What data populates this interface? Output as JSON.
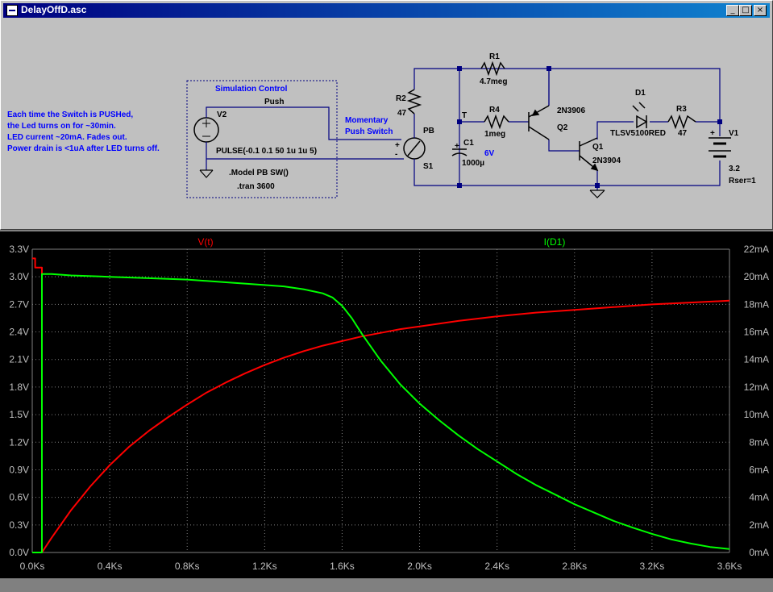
{
  "window": {
    "title": "DelayOffD.asc",
    "buttons": {
      "minimize": "_",
      "maximize": "□",
      "close": "×"
    }
  },
  "schematic": {
    "notes": [
      "Each time the Switch is PUSHed,",
      "the Led turns on for ~30min.",
      "LED current ~20mA. Fades out.",
      "Power drain is <1uA after LED turns off."
    ],
    "sim_box_title": "Simulation Control",
    "push_label": "Push",
    "v2_name": "V2",
    "v2_value": "PULSE(-0.1 0.1 50 1u 1u 5)",
    "model_line": ".Model PB SW()",
    "tran_line": ".tran 3600",
    "switch_note": [
      "Momentary",
      "Push Switch"
    ],
    "pb_label": "PB",
    "s1_label": "S1",
    "switch_plus": "+",
    "switch_minus": "-",
    "r2_name": "R2",
    "r2_value": "47",
    "r1_name": "R1",
    "r1_value": "4.7meg",
    "r4_name": "R4",
    "r4_value": "1meg",
    "node_t": "T",
    "c1_name": "C1",
    "c1_value": "1000µ",
    "c1_plus": "+",
    "node_6v": "6V",
    "q2_model": "2N3906",
    "q2_name": "Q2",
    "q1_name": "Q1",
    "q1_model": "2N3904",
    "d1_name": "D1",
    "d1_model": "TLSV5100RED",
    "r3_name": "R3",
    "r3_value": "47",
    "v1_name": "V1",
    "v1_value": "3.2",
    "v1_rser": "Rser=1",
    "v1_plus": "+",
    "colors": {
      "wire": "#000080",
      "component": "#000000",
      "note": "#0000ff",
      "node": "#0000ff"
    }
  },
  "plot": {
    "trace_labels": {
      "left": "V(t)",
      "right": "I(D1)"
    },
    "y_left_ticks": [
      "0.0V",
      "0.3V",
      "0.6V",
      "0.9V",
      "1.2V",
      "1.5V",
      "1.8V",
      "2.1V",
      "2.4V",
      "2.7V",
      "3.0V",
      "3.3V"
    ],
    "y_right_ticks": [
      "0mA",
      "2mA",
      "4mA",
      "6mA",
      "8mA",
      "10mA",
      "12mA",
      "14mA",
      "16mA",
      "18mA",
      "20mA",
      "22mA"
    ],
    "x_ticks": [
      "0.0Ks",
      "0.4Ks",
      "0.8Ks",
      "1.2Ks",
      "1.6Ks",
      "2.0Ks",
      "2.4Ks",
      "2.8Ks",
      "3.2Ks",
      "3.6Ks"
    ],
    "colors": {
      "background": "#000000",
      "grid": "#808080",
      "axis_text": "#c0c0c0",
      "vt": "#ff0000",
      "id1": "#00ff00"
    }
  },
  "chart_data": {
    "type": "line",
    "title": "",
    "xlabel": "",
    "ylabel": "",
    "xlim": [
      0,
      3600
    ],
    "ylim_left": [
      0,
      3.3
    ],
    "ylim_right": [
      0,
      22
    ],
    "grid": true,
    "series": [
      {
        "name": "V(t)",
        "axis": "left",
        "unit": "V",
        "color": "#ff0000",
        "points": [
          [
            0,
            3.2
          ],
          [
            15,
            3.2
          ],
          [
            15,
            3.1
          ],
          [
            50,
            3.1
          ],
          [
            50,
            0
          ],
          [
            100,
            0.16
          ],
          [
            200,
            0.46
          ],
          [
            300,
            0.72
          ],
          [
            400,
            0.95
          ],
          [
            500,
            1.15
          ],
          [
            600,
            1.32
          ],
          [
            700,
            1.47
          ],
          [
            800,
            1.61
          ],
          [
            900,
            1.74
          ],
          [
            1000,
            1.85
          ],
          [
            1100,
            1.95
          ],
          [
            1200,
            2.04
          ],
          [
            1300,
            2.12
          ],
          [
            1400,
            2.19
          ],
          [
            1500,
            2.25
          ],
          [
            1600,
            2.3
          ],
          [
            1700,
            2.35
          ],
          [
            1800,
            2.39
          ],
          [
            1900,
            2.43
          ],
          [
            2000,
            2.46
          ],
          [
            2200,
            2.52
          ],
          [
            2400,
            2.57
          ],
          [
            2600,
            2.61
          ],
          [
            2800,
            2.64
          ],
          [
            3000,
            2.67
          ],
          [
            3200,
            2.7
          ],
          [
            3400,
            2.72
          ],
          [
            3600,
            2.74
          ]
        ]
      },
      {
        "name": "I(D1)",
        "axis": "right",
        "unit": "mA",
        "color": "#00ff00",
        "points": [
          [
            0,
            0
          ],
          [
            50,
            0
          ],
          [
            50,
            20.2
          ],
          [
            100,
            20.2
          ],
          [
            200,
            20.1
          ],
          [
            400,
            20.0
          ],
          [
            600,
            19.9
          ],
          [
            800,
            19.8
          ],
          [
            1000,
            19.6
          ],
          [
            1200,
            19.4
          ],
          [
            1300,
            19.3
          ],
          [
            1400,
            19.1
          ],
          [
            1500,
            18.8
          ],
          [
            1550,
            18.5
          ],
          [
            1600,
            17.9
          ],
          [
            1650,
            17.0
          ],
          [
            1700,
            15.9
          ],
          [
            1800,
            13.9
          ],
          [
            1900,
            12.2
          ],
          [
            2000,
            10.8
          ],
          [
            2100,
            9.6
          ],
          [
            2200,
            8.5
          ],
          [
            2300,
            7.5
          ],
          [
            2400,
            6.6
          ],
          [
            2500,
            5.7
          ],
          [
            2600,
            4.9
          ],
          [
            2700,
            4.2
          ],
          [
            2800,
            3.5
          ],
          [
            2900,
            2.9
          ],
          [
            3000,
            2.3
          ],
          [
            3100,
            1.8
          ],
          [
            3200,
            1.35
          ],
          [
            3300,
            0.95
          ],
          [
            3400,
            0.65
          ],
          [
            3500,
            0.4
          ],
          [
            3600,
            0.25
          ]
        ]
      }
    ]
  }
}
